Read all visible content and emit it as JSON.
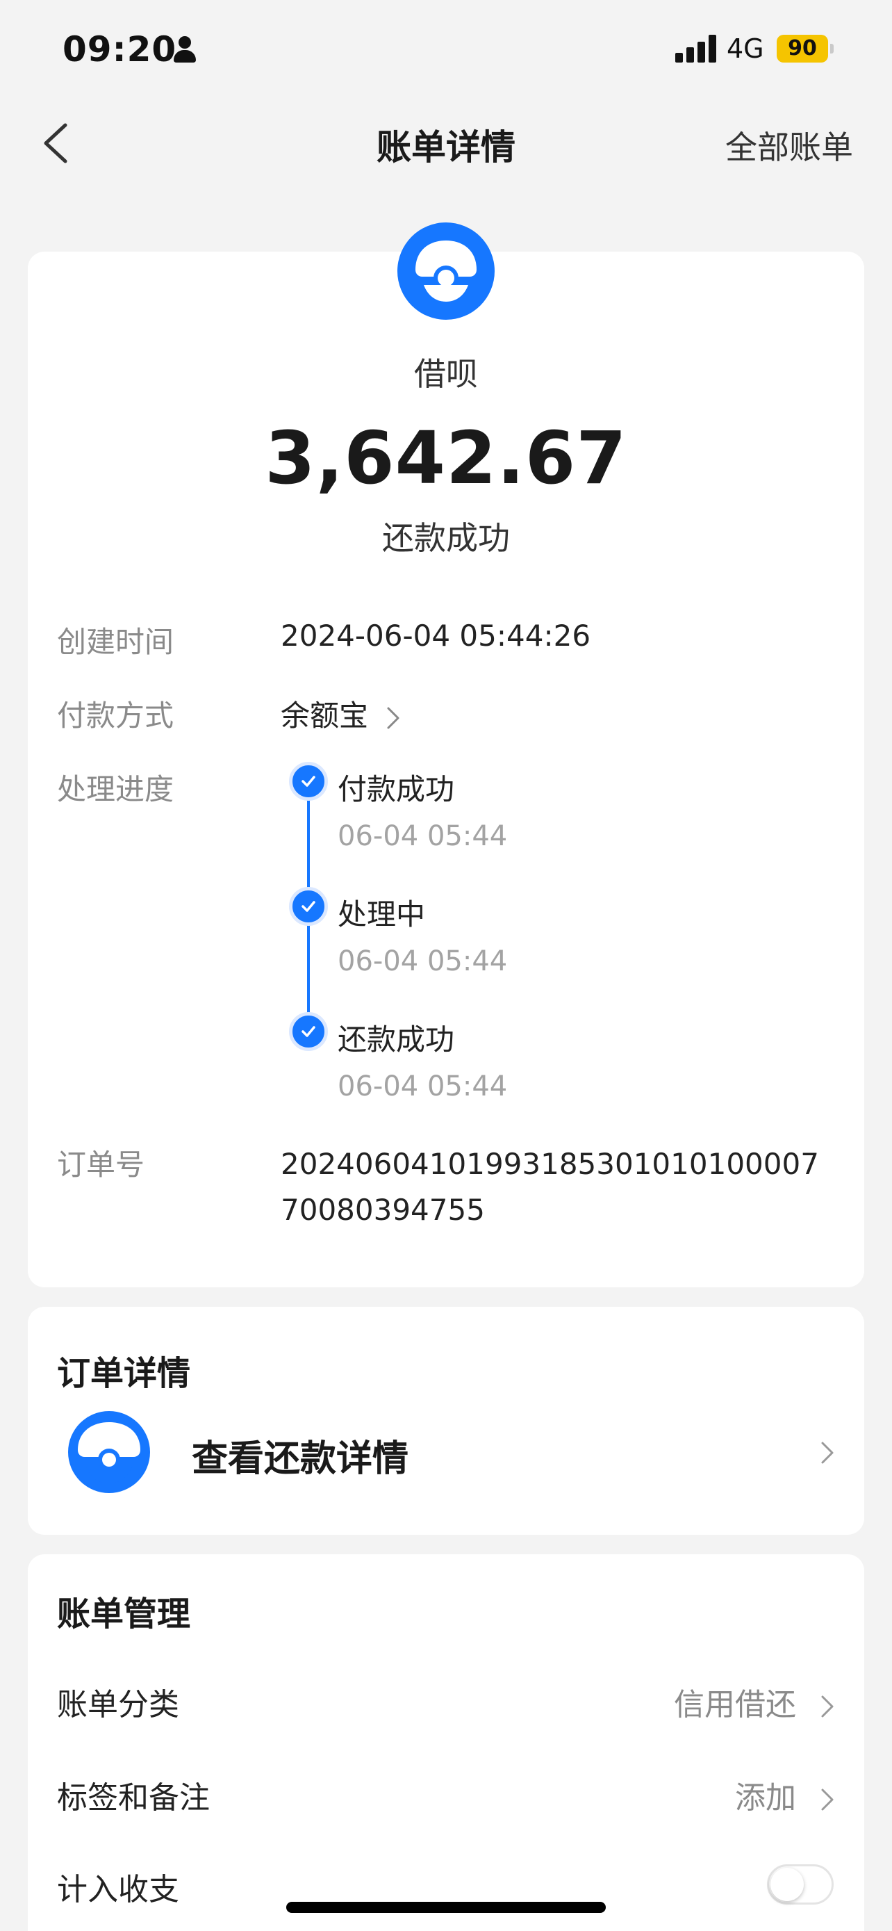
{
  "status_bar": {
    "time": "09:20",
    "network": "4G",
    "battery": "90",
    "battery_color": "#f5c400"
  },
  "nav": {
    "title": "账单详情",
    "right_action": "全部账单"
  },
  "bill": {
    "app_name": "借呗",
    "amount": "3,642.67",
    "status": "还款成功",
    "created_label": "创建时间",
    "created_value": "2024-06-04 05:44:26",
    "payment_label": "付款方式",
    "payment_value": "余额宝",
    "progress_label": "处理进度",
    "progress": [
      {
        "title": "付款成功",
        "time": "06-04 05:44"
      },
      {
        "title": "处理中",
        "time": "06-04 05:44"
      },
      {
        "title": "还款成功",
        "time": "06-04 05:44"
      }
    ],
    "order_no_label": "订单号",
    "order_no": "2024060410199318530101010000770080394755"
  },
  "order_details": {
    "title": "订单详情",
    "link_label": "查看还款详情"
  },
  "bill_management": {
    "title": "账单管理",
    "items": [
      {
        "label": "账单分类",
        "value": "信用借还"
      },
      {
        "label": "标签和备注",
        "value": "添加"
      },
      {
        "label": "计入收支",
        "value": ""
      }
    ],
    "include_toggle_on": false
  },
  "colors": {
    "accent": "#1677ff",
    "background": "#f3f3f3",
    "card": "#ffffff"
  }
}
